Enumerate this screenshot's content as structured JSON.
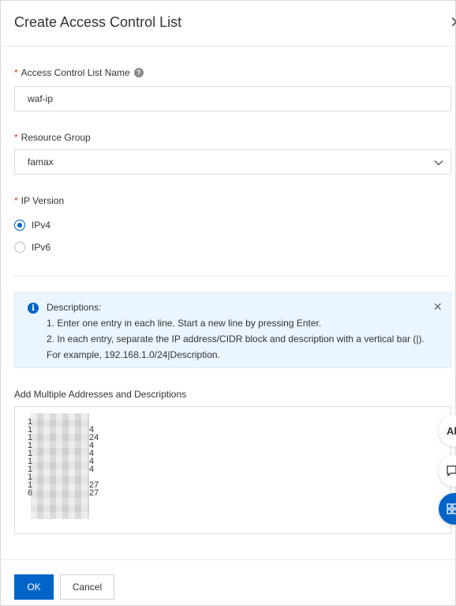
{
  "dialog": {
    "title": "Create Access Control List",
    "close_icon": "close-icon"
  },
  "acl_name": {
    "label": "Access Control List Name",
    "value": "waf-ip"
  },
  "resource_group": {
    "label": "Resource Group",
    "value": "famax"
  },
  "ip_version": {
    "label": "IP Version",
    "options": [
      "IPv4",
      "IPv6"
    ],
    "selected": "IPv4"
  },
  "notice": {
    "title": "Descriptions:",
    "lines": [
      "1. Enter one entry in each line. Start a new line by pressing Enter.",
      "2. In each entry, separate the IP address/CIDR block and description with a vertical bar (|).",
      "For example, 192.168.1.0/24|Description."
    ]
  },
  "addresses": {
    "label": "Add Multiple Addresses and Descriptions",
    "lines": [
      {
        "start": "1",
        "end": ""
      },
      {
        "start": "1",
        "end": "4"
      },
      {
        "start": "1",
        "end": "24"
      },
      {
        "start": "1",
        "end": "4"
      },
      {
        "start": "1",
        "end": "4"
      },
      {
        "start": "1",
        "end": "4"
      },
      {
        "start": "1",
        "end": "4"
      },
      {
        "start": "1",
        "end": ""
      },
      {
        "start": "1",
        "end": "27"
      },
      {
        "start": "6",
        "end": "27"
      }
    ]
  },
  "floating": {
    "text_button": "Al"
  },
  "footer": {
    "ok_label": "OK",
    "cancel_label": "Cancel"
  },
  "colors": {
    "primary": "#0064c8",
    "required": "#d93026",
    "notice_bg": "#ebf5ff"
  }
}
